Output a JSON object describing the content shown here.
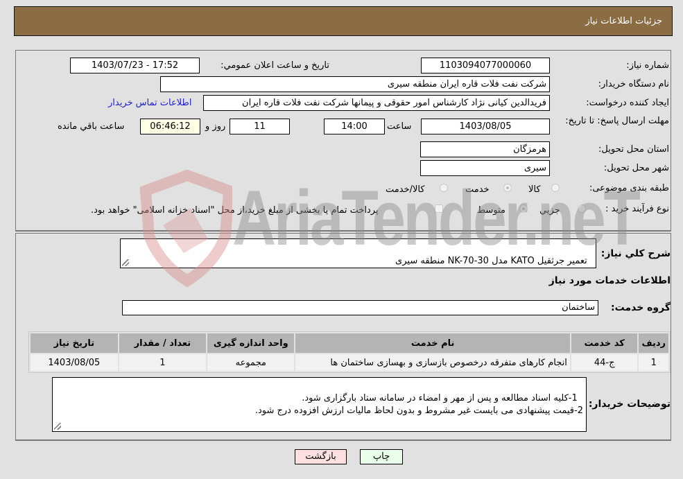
{
  "header": {
    "title": "جزئیات اطلاعات نیاز"
  },
  "fields": {
    "need_number_label": "شماره نیاز:",
    "need_number": "1103094077000060",
    "announce_label": "تاریخ و ساعت اعلان عمومي:",
    "announce_value": "1403/07/23 - 17:52",
    "buyer_org_label": "نام دستگاه خریدار:",
    "buyer_org": "شرکت نفت فلات قاره ایران منطقه سیری",
    "creator_label": "ایجاد کننده درخواست:",
    "creator": "فریدالدین کیانی نژاد کارشناس امور حقوقی و پیمانها شرکت نفت فلات قاره ایران",
    "contact_link": "اطلاعات تماس خریدار",
    "deadline_label": "مهلت ارسال پاسخ: تا تاریخ:",
    "deadline_date": "1403/08/05",
    "time_label": "ساعت",
    "deadline_time": "14:00",
    "days_value": "11",
    "days_label": "روز و",
    "remaining_time": "06:46:12",
    "remaining_label": "ساعت باقي مانده",
    "province_label": "استان محل تحویل:",
    "province": "هرمزگان",
    "city_label": "شهر محل تحویل:",
    "city": "سیری",
    "category_label": "طبقه بندی موضوعی:",
    "category_options": [
      "کالا",
      "خدمت",
      "کالا/خدمت"
    ],
    "category_selected": "خدمت",
    "process_label": "نوع فرآیند خرید :",
    "process_options": [
      "جزیي",
      "متوسط"
    ],
    "process_selected": "متوسط",
    "treasury_note": "پرداخت تمام یا بخشی از مبلغ خرید،از محل \"اسناد خزانه اسلامی\" خواهد بود."
  },
  "description": {
    "label": "شرح کلي نیاز:",
    "value": "تعمیر جرثقیل KATO مدل NK-70-30 منطقه سیری"
  },
  "services": {
    "section_title": "اطلاعات خدمات مورد نیاز",
    "group_label": "گروه خدمت:",
    "group_value": "ساختمان",
    "columns": [
      "ردیف",
      "کد خدمت",
      "نام خدمت",
      "واحد اندازه گیری",
      "تعداد / مقدار",
      "تاریخ نیاز"
    ],
    "rows": [
      [
        "1",
        "ج-44",
        "انجام کارهای متفرقه درخصوص بازسازی و بهسازی ساختمان ها",
        "مجموعه",
        "1",
        "1403/08/05"
      ]
    ]
  },
  "buyer_notes": {
    "label": "توضیحات خریدار:",
    "value": "1-کلیه اسناد مطالعه و پس از مهر و امضاء در سامانه ستاد بارگزاری شود.\n2-قیمت پیشنهادی می بایست غیر مشروط و بدون لحاظ مالیات ارزش افزوده درج شود."
  },
  "buttons": {
    "print": "چاپ",
    "back": "بازگشت"
  },
  "watermark": {
    "text": "AriaTender.neT"
  },
  "colors": {
    "header_bg": "#8b6d43",
    "print_bg": "#eaffea",
    "back_bg": "#ffe0e0",
    "remaining_bg": "#ffffe6",
    "link": "#2020d0"
  }
}
